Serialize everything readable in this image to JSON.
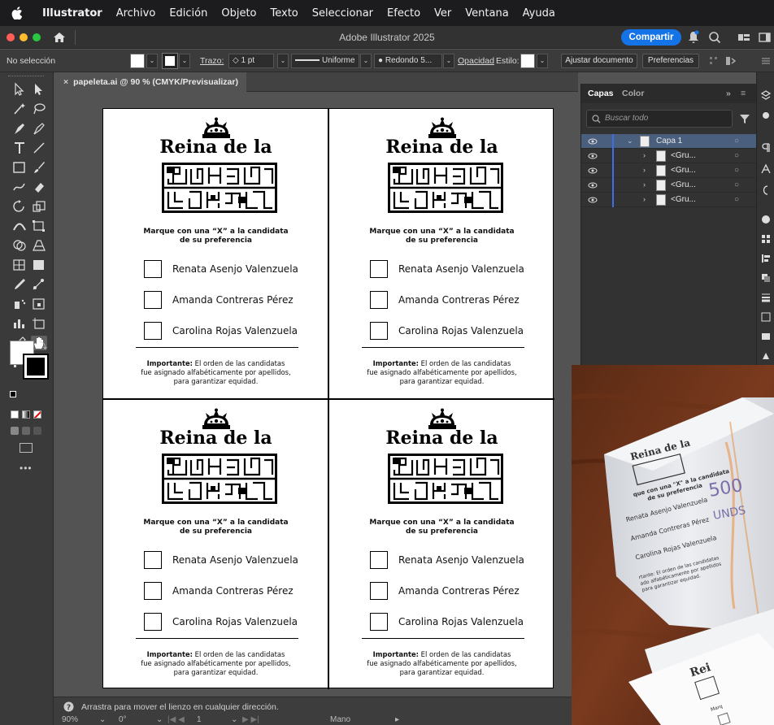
{
  "menubar": {
    "items": [
      "Illustrator",
      "Archivo",
      "Edición",
      "Objeto",
      "Texto",
      "Seleccionar",
      "Efecto",
      "Ver",
      "Ventana",
      "Ayuda"
    ]
  },
  "titlebar": {
    "title": "Adobe Illustrator 2025",
    "share_label": "Compartir"
  },
  "controlbar": {
    "selection_status": "No selección",
    "stroke_label": "Trazo:",
    "stroke_value": "1 pt",
    "stroke_profile": "Uniforme",
    "brush": "Redondo 5...",
    "opacity_label": "Opacidad",
    "style_label": "Estilo:",
    "fit_button": "Ajustar documento",
    "prefs_button": "Preferencias"
  },
  "document": {
    "tab_label": "papeleta.ai @ 90 % (CMYK/Previsualizar)"
  },
  "ballot": {
    "title": "Reina de la",
    "prompt_line1": "Marque con una “X” a la candidata",
    "prompt_line2": "de su preferencia",
    "candidates": [
      "Renata Asenjo Valenzuela",
      "Amanda Contreras Pérez",
      "Carolina Rojas Valenzuela"
    ],
    "note_bold": "Importante:",
    "note_rest1": " El orden de las candidatas",
    "note_line2": "fue asignado alfabéticamente por apellidos,",
    "note_line3": "para garantizar equidad."
  },
  "layers_panel": {
    "tab_layers": "Capas",
    "tab_color": "Color",
    "search_placeholder": "Buscar todo",
    "layer_name": "Capa 1",
    "group_label": "<Gru..."
  },
  "statusbar": {
    "hint": "Arrastra para mover el lienzo en cualquier dirección.",
    "zoom": "90%",
    "rotation": "0°",
    "artboard": "1",
    "tool": "Mano"
  },
  "colors": {
    "share_blue": "#1473e6",
    "layer_selected": "#4a5f7e",
    "layer_color_bar": "#3f6de5",
    "light_red": "#ff5f57",
    "light_yellow": "#febc2e",
    "light_green": "#28c840"
  }
}
